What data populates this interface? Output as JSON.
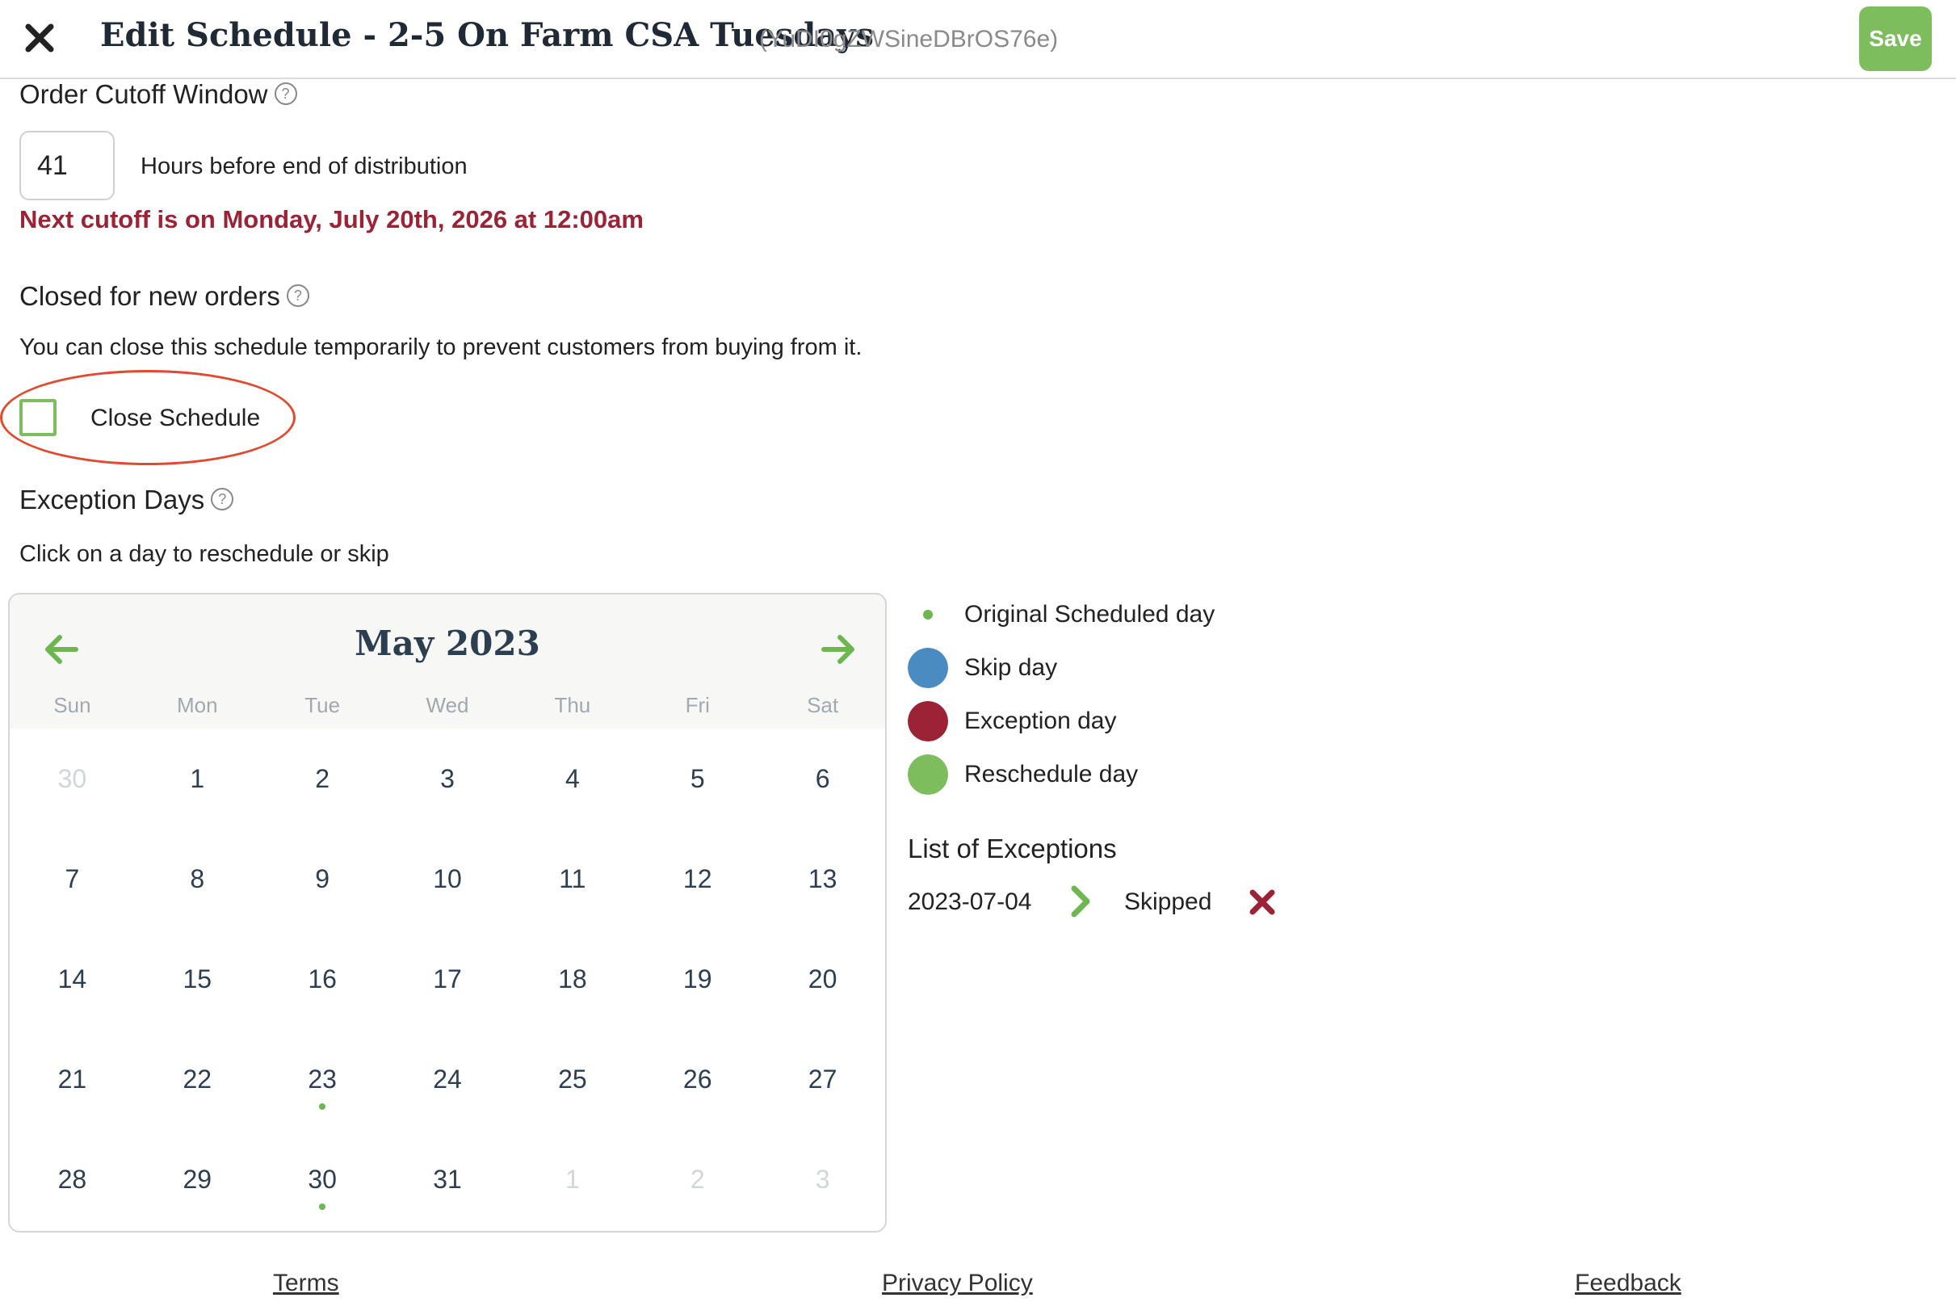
{
  "header": {
    "title": "Edit Schedule - 2-5 On Farm CSA Tuesdays",
    "schedule_id": "(YuDI0gZWSineDBrOS76e)",
    "save_label": "Save"
  },
  "cutoff": {
    "heading": "Order Cutoff Window",
    "hours_value": "41",
    "hours_label": "Hours before end of distribution",
    "next_cutoff": "Next cutoff is on Monday, July 20th, 2026 at 12:00am"
  },
  "closed": {
    "heading": "Closed for new orders",
    "description": "You can close this schedule temporarily to prevent customers from buying from it.",
    "checkbox_label": "Close Schedule"
  },
  "exceptions": {
    "heading": "Exception Days",
    "instruction": "Click on a day to reschedule or skip"
  },
  "calendar": {
    "title": "May 2023",
    "days_of_week": [
      "Sun",
      "Mon",
      "Tue",
      "Wed",
      "Thu",
      "Fri",
      "Sat"
    ],
    "weeks": [
      [
        "30",
        "1",
        "2",
        "3",
        "4",
        "5",
        "6"
      ],
      [
        "7",
        "8",
        "9",
        "10",
        "11",
        "12",
        "13"
      ],
      [
        "14",
        "15",
        "16",
        "17",
        "18",
        "19",
        "20"
      ],
      [
        "21",
        "22",
        "23",
        "24",
        "25",
        "26",
        "27"
      ],
      [
        "28",
        "29",
        "30",
        "31",
        "1",
        "2",
        "3"
      ]
    ]
  },
  "legend": {
    "items": [
      {
        "label": "Original Scheduled day",
        "color": "#6db650"
      },
      {
        "label": "Skip day",
        "color": "#4a8bc2"
      },
      {
        "label": "Exception day",
        "color": "#9b2335"
      },
      {
        "label": "Reschedule day",
        "color": "#7dbd5e"
      }
    ]
  },
  "exception_list": {
    "heading": "List of Exceptions",
    "items": [
      {
        "date": "2023-07-04",
        "status": "Skipped"
      }
    ]
  },
  "footer": {
    "terms": "Terms",
    "privacy": "Privacy Policy",
    "feedback": "Feedback"
  },
  "colors": {
    "accent_green": "#7dbd5e",
    "alert_red": "#9b2335",
    "annotation_red": "#e2492f"
  }
}
